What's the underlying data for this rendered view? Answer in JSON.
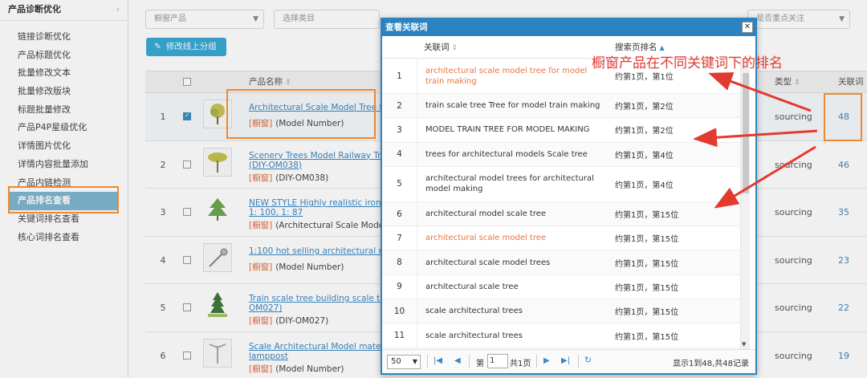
{
  "sidebar": {
    "header": "产品诊断优化",
    "items": [
      {
        "label": "链接诊断优化"
      },
      {
        "label": "产品标题优化"
      },
      {
        "label": "批量修改文本"
      },
      {
        "label": "批量修改版块"
      },
      {
        "label": "标题批量修改"
      },
      {
        "label": "产品P4P星级优化"
      },
      {
        "label": "详情图片优化"
      },
      {
        "label": "详情内容批量添加"
      },
      {
        "label": "产品内链检测"
      },
      {
        "label": "产品排名查看",
        "active": true
      },
      {
        "label": "关键词排名查看"
      },
      {
        "label": "核心词排名查看"
      }
    ]
  },
  "filters": {
    "showcase": "橱窗产品",
    "category": "选择类目",
    "key_focus": "是否重点关注"
  },
  "toolbar": {
    "group_button": "修改线上分组"
  },
  "table": {
    "col_name": "产品名称",
    "col_type": "类型",
    "col_keywords": "关联词",
    "rows": [
      {
        "index": "1",
        "title": "Architectural Scale Model Tree for",
        "title2": "",
        "tag": "[橱窗]",
        "model": "(Model Number)",
        "type": "sourcing",
        "count": "48",
        "checked": true
      },
      {
        "index": "2",
        "title": "Scenery Trees Model Railway Tree",
        "title2": "(DIY-OM038)",
        "tag": "[橱窗]",
        "model": "(DIY-OM038)",
        "type": "sourcing",
        "count": "46",
        "checked": false
      },
      {
        "index": "3",
        "title": "NEW STYLE Highly realistic iron w",
        "title2": "1: 100, 1: 87",
        "tag": "[橱窗]",
        "model": "(Architectural Scale Models",
        "type": "sourcing",
        "count": "35",
        "checked": false
      },
      {
        "index": "4",
        "title": "1:100 hot selling architectural mo",
        "title2": "",
        "tag": "[橱窗]",
        "model": "(Model Number)",
        "type": "sourcing",
        "count": "23",
        "checked": false
      },
      {
        "index": "5",
        "title": "Train scale tree building scale tree",
        "title2": "OM027)",
        "tag": "[橱窗]",
        "model": "(DIY-OM027)",
        "type": "sourcing",
        "count": "22",
        "checked": false
      },
      {
        "index": "6",
        "title": "Scale Architectural Model materia",
        "title2": "lamppost",
        "tag": "[橱窗]",
        "model": "(Model Number)",
        "type": "sourcing",
        "count": "19",
        "checked": false
      }
    ]
  },
  "dialog": {
    "title": "查看关联词",
    "close": "✕",
    "col_keyword": "关联词",
    "col_rank": "搜索页排名",
    "rows": [
      {
        "n": "1",
        "keyword": "architectural scale model tree for model train making",
        "rank": "约第1页，第1位",
        "hot": true,
        "tall": true
      },
      {
        "n": "2",
        "keyword": "train scale tree Tree for model train making",
        "rank": "约第1页，第2位",
        "hot": false,
        "tall": false
      },
      {
        "n": "3",
        "keyword": "MODEL TRAIN TREE FOR MODEL MAKING",
        "rank": "约第1页，第2位",
        "hot": false,
        "tall": false
      },
      {
        "n": "4",
        "keyword": "trees for architectural models Scale tree",
        "rank": "约第1页，第4位",
        "hot": false,
        "tall": false
      },
      {
        "n": "5",
        "keyword": "architectural model trees for architectural model making",
        "rank": "约第1页，第4位",
        "hot": false,
        "tall": true
      },
      {
        "n": "6",
        "keyword": "architectural model scale tree",
        "rank": "约第1页，第15位",
        "hot": false,
        "tall": false
      },
      {
        "n": "7",
        "keyword": "architectural scale model tree",
        "rank": "约第1页，第15位",
        "hot": true,
        "tall": false
      },
      {
        "n": "8",
        "keyword": "architectural scale model trees",
        "rank": "约第1页，第15位",
        "hot": false,
        "tall": false
      },
      {
        "n": "9",
        "keyword": "architectural scale tree",
        "rank": "约第1页，第15位",
        "hot": false,
        "tall": false
      },
      {
        "n": "10",
        "keyword": "scale architectural trees",
        "rank": "约第1页，第15位",
        "hot": false,
        "tall": false
      },
      {
        "n": "11",
        "keyword": "scale architectural trees",
        "rank": "约第1页，第15位",
        "hot": false,
        "tall": false
      }
    ],
    "pager": {
      "page_size": "50",
      "page_prefix": "第",
      "page_value": "1",
      "page_total": "共1页",
      "info": "显示1到48,共48记录"
    }
  },
  "annotation": {
    "text": "橱窗产品在不同关键词下的排名",
    "color": "#e23a2f"
  },
  "colors": {
    "accent": "#2b84c0",
    "highlight": "#f0882e",
    "hot_keyword": "#e8733c"
  }
}
